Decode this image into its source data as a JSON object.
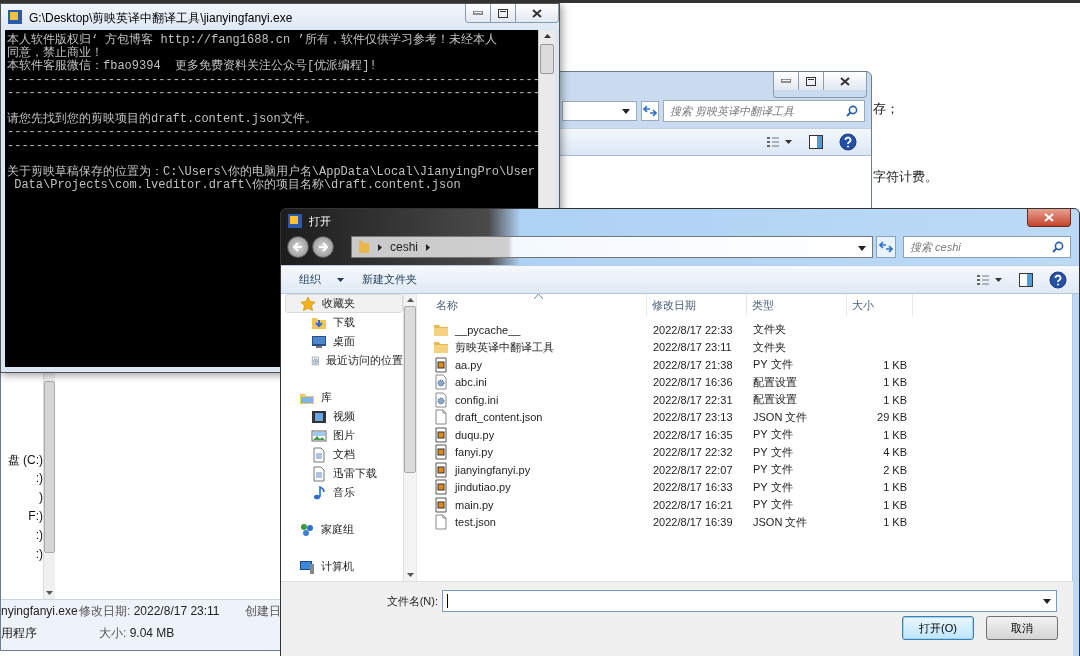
{
  "document": {
    "texts": [
      "存；",
      "字符计费。"
    ]
  },
  "explorer": {
    "search_placeholder": "搜索 剪映英译中翻译工具",
    "drives": [
      "盘 (C:)",
      ":)",
      ")",
      "F:)",
      ":)",
      ":)"
    ],
    "details": {
      "name": "nyingfanyi.exe",
      "modified_label": "修改日期:",
      "modified": "2022/8/17 23:11",
      "created_label": "创建日",
      "type": "用程序",
      "size_label": "大小:",
      "size": "9.04 MB"
    }
  },
  "console": {
    "title": "G:\\Desktop\\剪映英译中翻译工具\\jianyingfanyi.exe",
    "lines": [
      {
        "kind": "text",
        "text": "本人软件版权归‘ 方包博客 http://fang1688.cn ’所有，软件仅供学习参考！未经本人"
      },
      {
        "kind": "text",
        "text": "同意，禁止商业！"
      },
      {
        "kind": "text",
        "text": "本软件客服微信：fbao9394  更多免费资料关注公众号[优派编程]!"
      },
      {
        "kind": "text",
        "text": "--------------------------------------------------------------------------"
      },
      {
        "kind": "text",
        "text": "--------------------------------------------------------------------------"
      },
      {
        "kind": "blank"
      },
      {
        "kind": "text",
        "text": "请您先找到您的剪映项目的draft.content.json文件。"
      },
      {
        "kind": "text",
        "text": "--------------------------------------------------------------------------"
      },
      {
        "kind": "text",
        "text": "--------------------------------------------------------------------------"
      },
      {
        "kind": "blank"
      },
      {
        "kind": "text",
        "text": "关于剪映草稿保存的位置为：C:\\Users\\你的电脑用户名\\AppData\\Local\\JianyingPro\\User"
      },
      {
        "kind": "text",
        "text": " Data\\Projects\\com.lveditor.draft\\你的项目名称\\draft.content.json"
      }
    ]
  },
  "dialog": {
    "title": "打开",
    "path": [
      "ceshi"
    ],
    "search_placeholder": "搜索 ceshi",
    "toolbar": [
      {
        "label": "组织",
        "kind": "menu"
      },
      {
        "label": "新建文件夹",
        "kind": "button"
      }
    ],
    "sidebar": [
      {
        "label": "收藏夹",
        "kind": "star",
        "selected": true,
        "children": [
          {
            "label": "下载",
            "kind": "download",
            "selected": false
          },
          {
            "label": "桌面",
            "kind": "desktop",
            "selected": false
          },
          {
            "label": "最近访问的位置",
            "kind": "recent",
            "selected": false
          }
        ]
      },
      {
        "label": "库",
        "kind": "library",
        "selected": false,
        "children": [
          {
            "label": "视频",
            "kind": "video",
            "selected": false
          },
          {
            "label": "图片",
            "kind": "picture",
            "selected": false
          },
          {
            "label": "文档",
            "kind": "document",
            "selected": false
          },
          {
            "label": "迅雷下载",
            "kind": "document",
            "selected": false
          },
          {
            "label": "音乐",
            "kind": "music",
            "selected": false
          }
        ]
      },
      {
        "label": "家庭组",
        "kind": "homegroup",
        "selected": false
      },
      {
        "label": "计算机",
        "kind": "computer",
        "selected": false
      }
    ],
    "columns": [
      "名称",
      "修改日期",
      "类型",
      "大小"
    ],
    "files": [
      {
        "name": "__pycache__",
        "date": "2022/8/17 22:33",
        "type": "文件夹",
        "kind": "folder"
      },
      {
        "name": "剪映英译中翻译工具",
        "date": "2022/8/17 23:11",
        "type": "文件夹",
        "kind": "folder"
      },
      {
        "name": "aa.py",
        "date": "2022/8/17 21:38",
        "type": "PY 文件",
        "size": "1 KB",
        "kind": "py"
      },
      {
        "name": "abc.ini",
        "date": "2022/8/17 16:36",
        "type": "配置设置",
        "size": "1 KB",
        "kind": "ini"
      },
      {
        "name": "config.ini",
        "date": "2022/8/17 22:31",
        "type": "配置设置",
        "size": "1 KB",
        "kind": "ini"
      },
      {
        "name": "draft_content.json",
        "date": "2022/8/17 23:13",
        "type": "JSON 文件",
        "size": "29 KB",
        "kind": "json"
      },
      {
        "name": "duqu.py",
        "date": "2022/8/17 16:35",
        "type": "PY 文件",
        "size": "1 KB",
        "kind": "py"
      },
      {
        "name": "fanyi.py",
        "date": "2022/8/17 22:32",
        "type": "PY 文件",
        "size": "4 KB",
        "kind": "py"
      },
      {
        "name": "jianyingfanyi.py",
        "date": "2022/8/17 22:07",
        "type": "PY 文件",
        "size": "2 KB",
        "kind": "py"
      },
      {
        "name": "jindutiao.py",
        "date": "2022/8/17 16:33",
        "type": "PY 文件",
        "size": "1 KB",
        "kind": "py"
      },
      {
        "name": "main.py",
        "date": "2022/8/17 16:21",
        "type": "PY 文件",
        "size": "1 KB",
        "kind": "py"
      },
      {
        "name": "test.json",
        "date": "2022/8/17 16:39",
        "type": "JSON 文件",
        "size": "1 KB",
        "kind": "json"
      }
    ],
    "filename_label": "文件名(N):",
    "buttons": [
      "打开(O)",
      "取消"
    ]
  }
}
